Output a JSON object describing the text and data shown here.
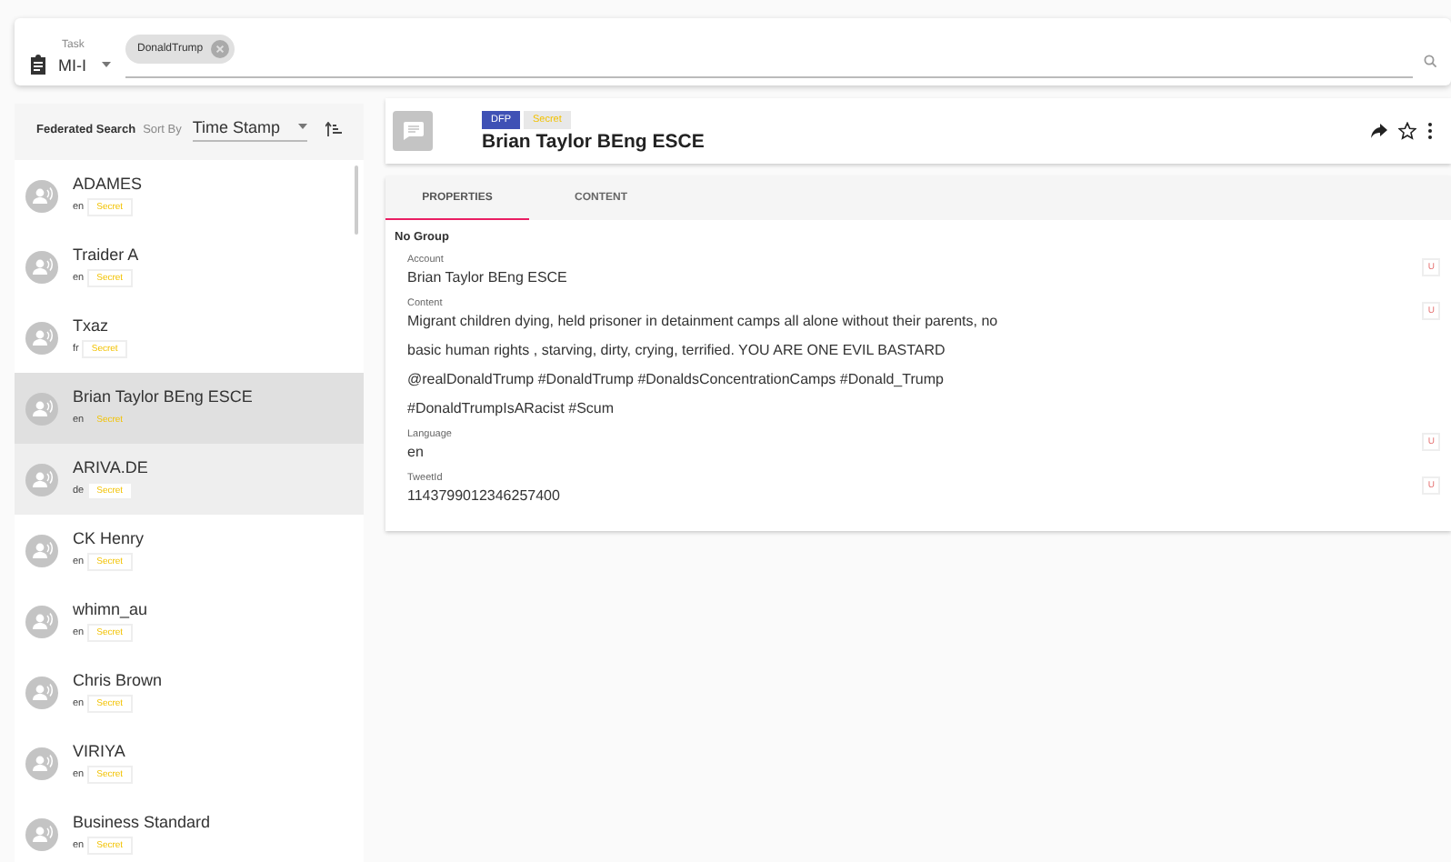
{
  "task": {
    "label": "Task",
    "value": "MI-I",
    "chips": [
      {
        "label": "DonaldTrump"
      }
    ]
  },
  "left_panel": {
    "title": "Federated Search",
    "sort_label": "Sort By",
    "sort_value": "Time Stamp",
    "items": [
      {
        "name": "ADAMES",
        "language": "en",
        "classification": "Secret",
        "selected": false,
        "hovered": false
      },
      {
        "name": "Traider A",
        "language": "en",
        "classification": "Secret",
        "selected": false,
        "hovered": false
      },
      {
        "name": "Txaz",
        "language": "fr",
        "classification": "Secret",
        "selected": false,
        "hovered": false
      },
      {
        "name": "Brian Taylor BEng ESCE",
        "language": "en",
        "classification": "Secret",
        "selected": true,
        "hovered": false
      },
      {
        "name": "ARIVA.DE",
        "language": "de",
        "classification": "Secret",
        "selected": false,
        "hovered": true
      },
      {
        "name": "CK Henry",
        "language": "en",
        "classification": "Secret",
        "selected": false,
        "hovered": false
      },
      {
        "name": "whimn_au",
        "language": "en",
        "classification": "Secret",
        "selected": false,
        "hovered": false
      },
      {
        "name": "Chris Brown",
        "language": "en",
        "classification": "Secret",
        "selected": false,
        "hovered": false
      },
      {
        "name": "VIRIYA",
        "language": "en",
        "classification": "Secret",
        "selected": false,
        "hovered": false
      },
      {
        "name": "Business Standard",
        "language": "en",
        "classification": "Secret",
        "selected": false,
        "hovered": false
      }
    ]
  },
  "detail": {
    "badges": [
      {
        "label": "DFP",
        "kind": "source"
      },
      {
        "label": "Secret",
        "kind": "classification"
      }
    ],
    "title": "Brian Taylor BEng ESCE",
    "tabs": [
      {
        "label": "PROPERTIES",
        "selected": true
      },
      {
        "label": "CONTENT",
        "selected": false
      }
    ],
    "group": "No Group",
    "properties": [
      {
        "label": "Account",
        "value": "Brian Taylor BEng ESCE",
        "marking": "U"
      },
      {
        "label": "Content",
        "value": "Migrant children dying, held prisoner in detainment camps all alone without their parents, no basic human rights , starving, dirty, crying, terrified. YOU ARE ONE EVIL BASTARD @realDonaldTrump #DonaldTrump #DonaldsConcentrationCamps #Donald_Trump #DonaldTrumpIsARacist #Scum",
        "marking": "U"
      },
      {
        "label": "Language",
        "value": "en",
        "marking": "U"
      },
      {
        "label": "TweetId",
        "value": "1143799012346257400",
        "marking": "U"
      }
    ]
  }
}
